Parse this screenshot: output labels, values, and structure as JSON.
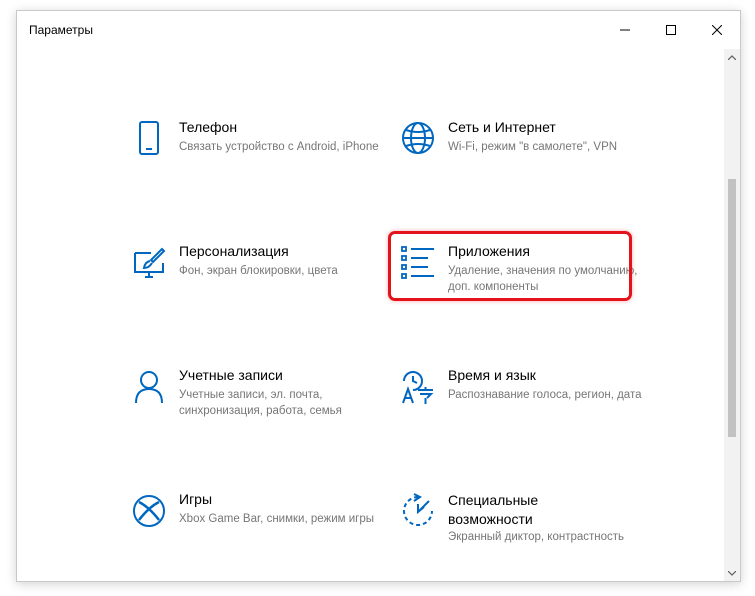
{
  "window": {
    "title": "Параметры"
  },
  "colors": {
    "accent": "#0067c0",
    "highlight": "#e3121b",
    "description_text": "#767676"
  },
  "tiles": [
    {
      "id": "phone",
      "icon": "phone-icon",
      "title": "Телефон",
      "description": "Связать устройство с Android, iPhone"
    },
    {
      "id": "network",
      "icon": "globe-icon",
      "title": "Сеть и Интернет",
      "description": "Wi-Fi, режим \"в самолете\", VPN"
    },
    {
      "id": "personalization",
      "icon": "paint-brush-monitor-icon",
      "title": "Персонализация",
      "description": "Фон, экран блокировки, цвета"
    },
    {
      "id": "apps",
      "icon": "apps-list-icon",
      "title": "Приложения",
      "description": "Удаление, значения по умолчанию, доп. компоненты",
      "highlighted": true
    },
    {
      "id": "accounts",
      "icon": "person-icon",
      "title": "Учетные записи",
      "description": "Учетные записи, эл. почта, синхронизация, работа, семья"
    },
    {
      "id": "time-language",
      "icon": "time-language-icon",
      "title": "Время и язык",
      "description": "Распознавание голоса, регион, дата"
    },
    {
      "id": "gaming",
      "icon": "xbox-icon",
      "title": "Игры",
      "description": "Xbox Game Bar, снимки, режим игры"
    },
    {
      "id": "accessibility",
      "icon": "accessibility-icon",
      "title": "Специальные возможности",
      "description": "Экранный диктор, контрастность"
    }
  ]
}
